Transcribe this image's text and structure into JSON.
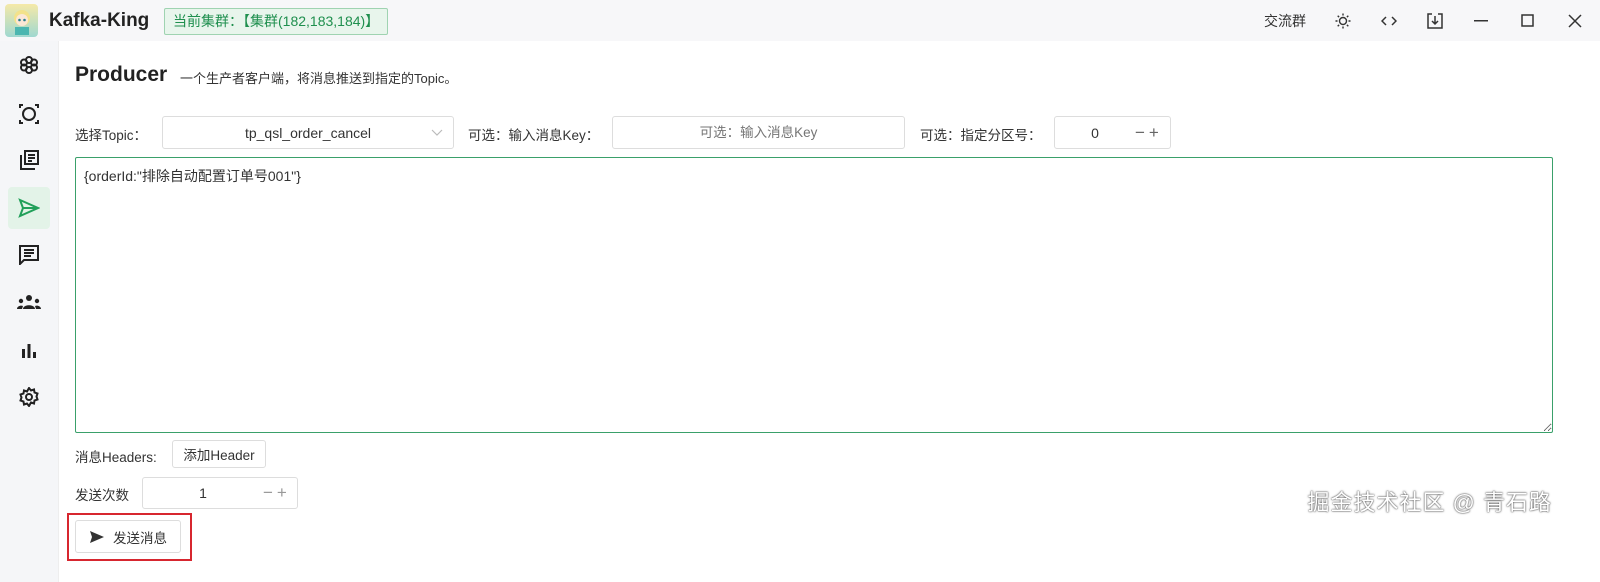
{
  "app": {
    "title": "Kafka-King",
    "cluster_label": "当前集群：【集群(182,183,184)】"
  },
  "titlebar": {
    "community": "交流群",
    "icons": [
      "sun-icon",
      "code-icon",
      "download-icon",
      "minimize-icon",
      "maximize-icon",
      "close-icon"
    ]
  },
  "sidebar": {
    "items": [
      "cluster-icon",
      "node-icon",
      "topic-icon",
      "producer-icon",
      "consumer-icon",
      "group-icon",
      "chart-icon",
      "settings-icon"
    ],
    "active": 3
  },
  "page": {
    "title": "Producer",
    "subtitle": "一个生产者客户端，将消息推送到指定的Topic。"
  },
  "form": {
    "topic_label": "选择Topic：",
    "topic_value": "tp_qsl_order_cancel",
    "key_label": "可选：输入消息Key：",
    "key_placeholder": "可选：输入消息Key",
    "partition_label": "可选：指定分区号：",
    "partition_value": "0",
    "message": "{orderId:\"排除自动配置订单号001\"}",
    "headers_label": "消息Headers:",
    "add_header": "添加Header",
    "count_label": "发送次数",
    "count_value": "1",
    "send_label": "发送消息"
  },
  "watermark": "掘金技术社区 @ 青石路",
  "colors": {
    "accent": "#1f8f4e",
    "highlight": "#d7262f"
  }
}
